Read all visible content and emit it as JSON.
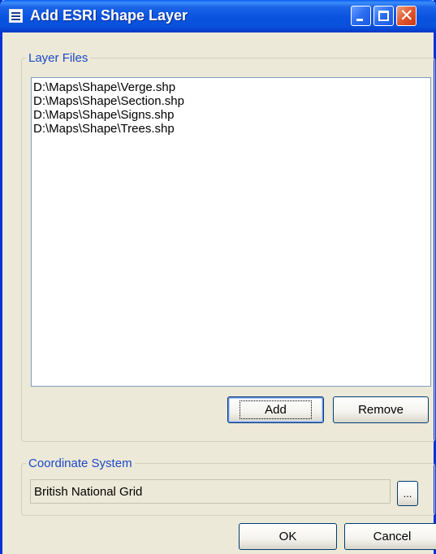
{
  "window": {
    "title": "Add ESRI Shape Layer",
    "close_glyph": "✕"
  },
  "layer_files": {
    "legend": "Layer Files",
    "items": [
      "D:\\Maps\\Shape\\Verge.shp",
      "D:\\Maps\\Shape\\Section.shp",
      "D:\\Maps\\Shape\\Signs.shp",
      "D:\\Maps\\Shape\\Trees.shp"
    ],
    "add_label": "Add",
    "remove_label": "Remove"
  },
  "coordinate_system": {
    "legend": "Coordinate System",
    "value": "British National Grid",
    "browse_label": "..."
  },
  "dialog": {
    "ok_label": "OK",
    "cancel_label": "Cancel"
  },
  "colors": {
    "titlebar": "#0a52e0",
    "group_legend": "#1c48c8",
    "dialog_bg": "#ece9d8"
  }
}
